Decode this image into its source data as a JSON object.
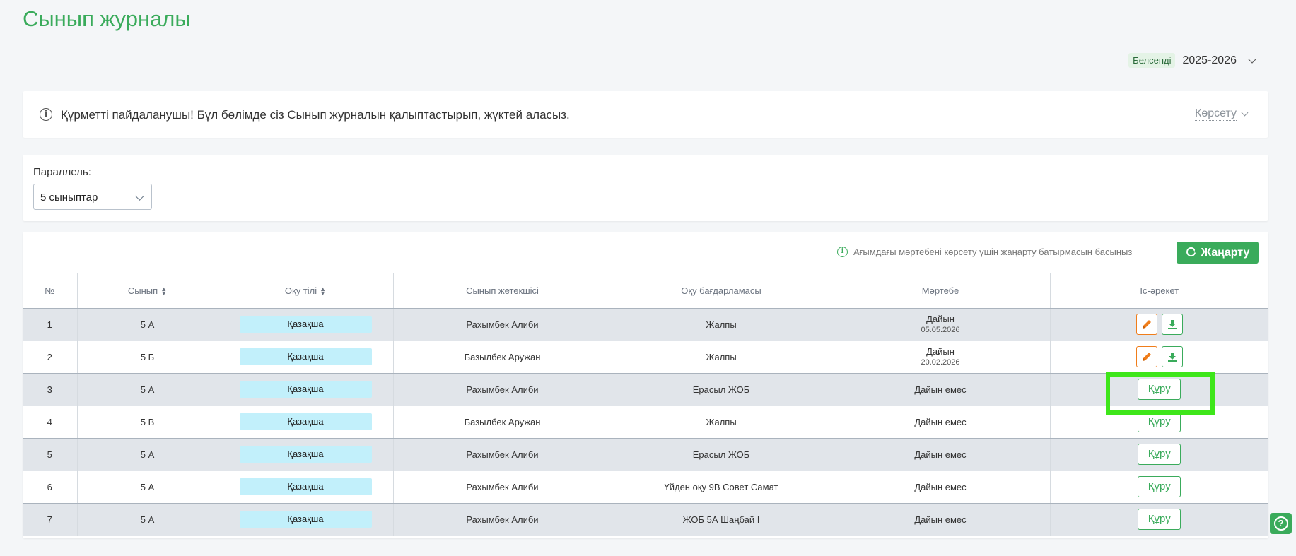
{
  "page": {
    "title": "Сынып журналы"
  },
  "year_selector": {
    "badge": "Белсенді",
    "year": "2025-2026"
  },
  "info": {
    "message": "Құрметті пайдаланушы! Бұл бөлімде сіз Сынып журналын қалыптастырып, жүктей аласыз.",
    "show_label": "Көрсету"
  },
  "filter": {
    "label": "Параллель:",
    "value": "5 сыныптар"
  },
  "toolbar": {
    "hint": "Ағымдағы мәртебені көрсету үшін жаңарту батырмасын басыңыз",
    "refresh_label": "Жаңарту"
  },
  "table": {
    "headers": {
      "num": "№",
      "class": "Сынып",
      "language": "Оқу тілі",
      "teacher": "Сынып жетекшісі",
      "program": "Оқу бағдарламасы",
      "status": "Мәртебе",
      "action": "Іс-әрекет"
    },
    "rows": [
      {
        "num": "1",
        "class": "5 А",
        "language": "Қазақша",
        "teacher": "Рахымбек Алиби",
        "program": "Жалпы",
        "status": "Дайын",
        "date": "05.05.2026"
      },
      {
        "num": "2",
        "class": "5 Б",
        "language": "Қазақша",
        "teacher": "Базылбек Аружан",
        "program": "Жалпы",
        "status": "Дайын",
        "date": "20.02.2026"
      },
      {
        "num": "3",
        "class": "5 А",
        "language": "Қазақша",
        "teacher": "Рахымбек Алиби",
        "program": "Ерасыл ЖОБ",
        "status": "Дайын емес",
        "action": "Құру"
      },
      {
        "num": "4",
        "class": "5 В",
        "language": "Қазақша",
        "teacher": "Базылбек Аружан",
        "program": "Жалпы",
        "status": "Дайын емес",
        "action": "Құру"
      },
      {
        "num": "5",
        "class": "5 А",
        "language": "Қазақша",
        "teacher": "Рахымбек Алиби",
        "program": "Ерасыл ЖОБ",
        "status": "Дайын емес",
        "action": "Құру"
      },
      {
        "num": "6",
        "class": "5 А",
        "language": "Қазақша",
        "teacher": "Рахымбек Алиби",
        "program": "Үйден оқу 9В Совет Самат",
        "status": "Дайын емес",
        "action": "Құру"
      },
      {
        "num": "7",
        "class": "5 А",
        "language": "Қазақша",
        "teacher": "Рахымбек Алиби",
        "program": "ЖОБ 5А Шаңбай І",
        "status": "Дайын емес",
        "action": "Құру"
      }
    ]
  },
  "colors": {
    "accent": "#3aab5b",
    "edit": "#f07d1a",
    "chip": "#c2f0fb",
    "highlight": "#3ee61a"
  }
}
